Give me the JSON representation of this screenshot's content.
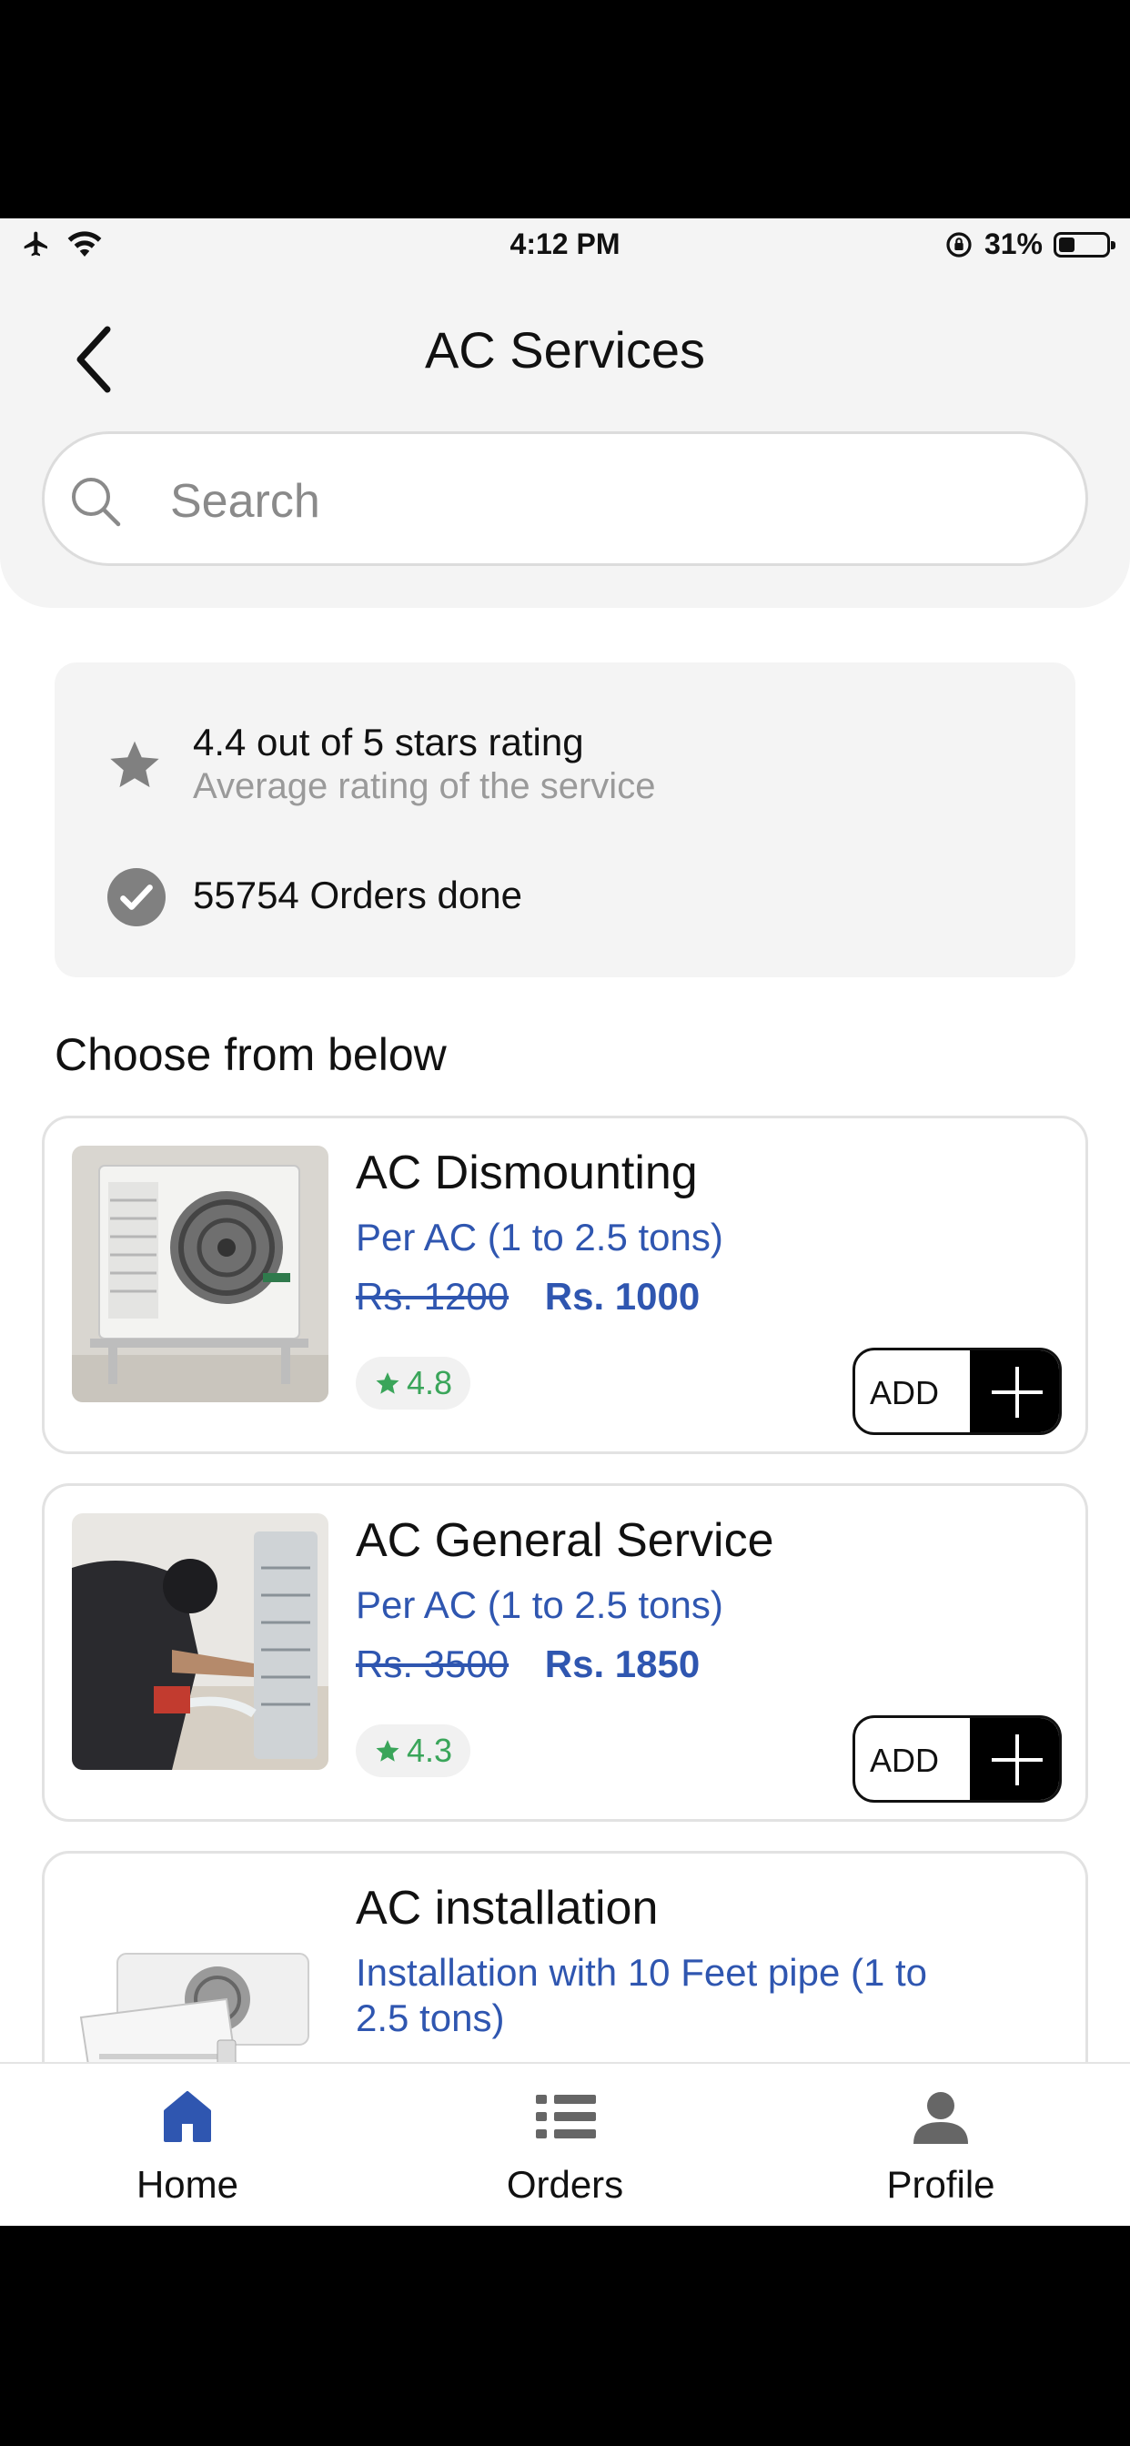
{
  "status_bar": {
    "time": "4:12 PM",
    "battery": "31%"
  },
  "header": {
    "title": "AC Services",
    "search_placeholder": "Search"
  },
  "info": {
    "rating_text": "4.4 out of 5 stars rating",
    "rating_sub": "Average rating of the service",
    "orders_text": "55754 Orders done"
  },
  "section_title": "Choose from below",
  "services": [
    {
      "name": "AC Dismounting",
      "desc": "Per AC (1 to 2.5 tons)",
      "old_price": "Rs. 1200",
      "new_price": "Rs. 1000",
      "rating": "4.8",
      "add_label": "ADD"
    },
    {
      "name": "AC General Service",
      "desc": "Per AC (1 to 2.5 tons)",
      "old_price": "Rs. 3500",
      "new_price": "Rs. 1850",
      "rating": "4.3",
      "add_label": "ADD"
    },
    {
      "name": "AC installation",
      "desc": "Installation with 10 Feet pipe (1 to 2.5 tons)"
    }
  ],
  "tabs": [
    {
      "label": "Home",
      "icon": "home-icon",
      "active": true
    },
    {
      "label": "Orders",
      "icon": "list-icon",
      "active": false
    },
    {
      "label": "Profile",
      "icon": "person-icon",
      "active": false
    }
  ],
  "colors": {
    "accent": "#2f56b0",
    "rating_green": "#3aa55a",
    "header_bg": "#f4f4f4"
  }
}
